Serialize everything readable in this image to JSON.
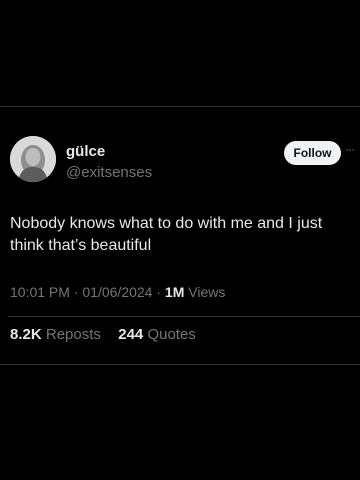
{
  "author": {
    "name": "gülce",
    "handle": "@exitsenses",
    "avatar_icon": "profile-avatar"
  },
  "actions": {
    "follow_label": "Follow",
    "more_icon": "more-horizontal-icon",
    "more_glyph": "···"
  },
  "tweet": {
    "text": "Nobody knows what to do with me and I just think that’s beautiful"
  },
  "meta": {
    "time": "10:01 PM",
    "separator": "·",
    "date": "01/06/2024",
    "views_count": "1M",
    "views_label": "Views"
  },
  "stats": {
    "reposts_count": "8.2K",
    "reposts_label": "Reposts",
    "quotes_count": "244",
    "quotes_label": "Quotes"
  },
  "colors": {
    "background": "#000000",
    "text_primary": "#e7e9ea",
    "text_secondary": "#71767b",
    "divider": "#2f3336",
    "follow_bg": "#eff3f4"
  }
}
